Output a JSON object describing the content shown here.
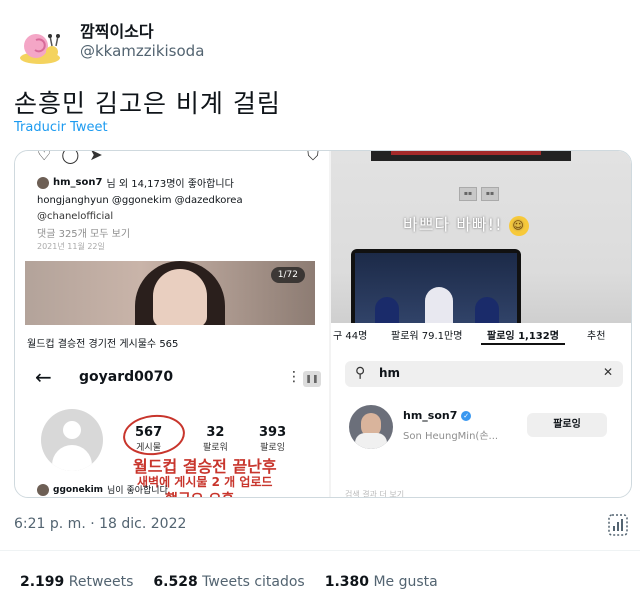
{
  "tweet": {
    "display_name": "깜찍이소다",
    "handle": "@kkamzzikisoda",
    "text": "손흥민 김고은 비계 걸림",
    "translate_label": "Traducir Tweet",
    "timestamp": "6:21 p. m. · 18 dic. 2022"
  },
  "left_image": {
    "likes_line": {
      "user": "hm_son7",
      "rest": "님 외 14,173명이 좋아합니다"
    },
    "caption_line1": "hongjanghyun @ggonekim @dazedkorea",
    "caption_line2": "@chanelofficial",
    "comments_link": "댓글 325개 모두 보기",
    "date_line": "2021년 11월 22일",
    "photo_counter": "1/72",
    "worldcup_line": "월드컵 결승전 경기전 게시물수 565",
    "profile_username": "goyard0070",
    "stats": [
      {
        "num": "567",
        "label": "게시물"
      },
      {
        "num": "32",
        "label": "팔로워"
      },
      {
        "num": "393",
        "label": "팔로잉"
      }
    ],
    "annotation1": "월드컵 결승전 끝난후",
    "annotation2": "새벽에 게시물 2 개 업로드",
    "annotation3": "했군요 오홍",
    "bottom_like": {
      "user": "ggonekim",
      "rest": "님이 좋아합니다"
    }
  },
  "right_image": {
    "overlay_text": "바쁘다 바빠!!",
    "tabs": [
      "구 44명",
      "팔로워 79.1만명",
      "팔로잉 1,132명",
      "추천"
    ],
    "search_value": "hm",
    "result_name": "hm_son7",
    "result_sub": "Son HeungMin(손...",
    "follow_label": "팔로잉",
    "blur_text": "검색 결과 더 보기"
  },
  "engagement": [
    {
      "num": "2.199",
      "label": "Retweets"
    },
    {
      "num": "6.528",
      "label": "Tweets citados"
    },
    {
      "num": "1.380",
      "label": "Me gusta"
    }
  ],
  "colors": {
    "link": "#1d9bf0",
    "annotation_red": "#c8352c",
    "muted": "#536471"
  }
}
